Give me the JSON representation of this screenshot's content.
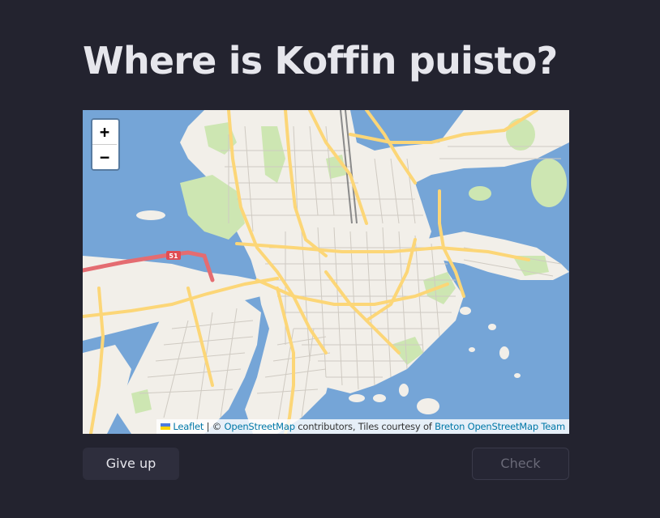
{
  "question": {
    "title": "Where is Koffin puisto?"
  },
  "map": {
    "zoom_in_label": "+",
    "zoom_out_label": "−",
    "road_shield": "51",
    "colors": {
      "water": "#75a5d7",
      "land": "#f2efe9",
      "park": "#cde6b2",
      "major_road": "#fcd677",
      "motorway": "#e46c71",
      "rail": "#8a8a8a"
    },
    "attribution": {
      "leaflet_link": "Leaflet",
      "separator": " | © ",
      "osm_link": "OpenStreetMap",
      "middle_text": " contributors, Tiles courtesy of ",
      "breton_link": "Breton OpenStreetMap Team"
    }
  },
  "actions": {
    "give_up_label": "Give up",
    "check_label": "Check"
  }
}
